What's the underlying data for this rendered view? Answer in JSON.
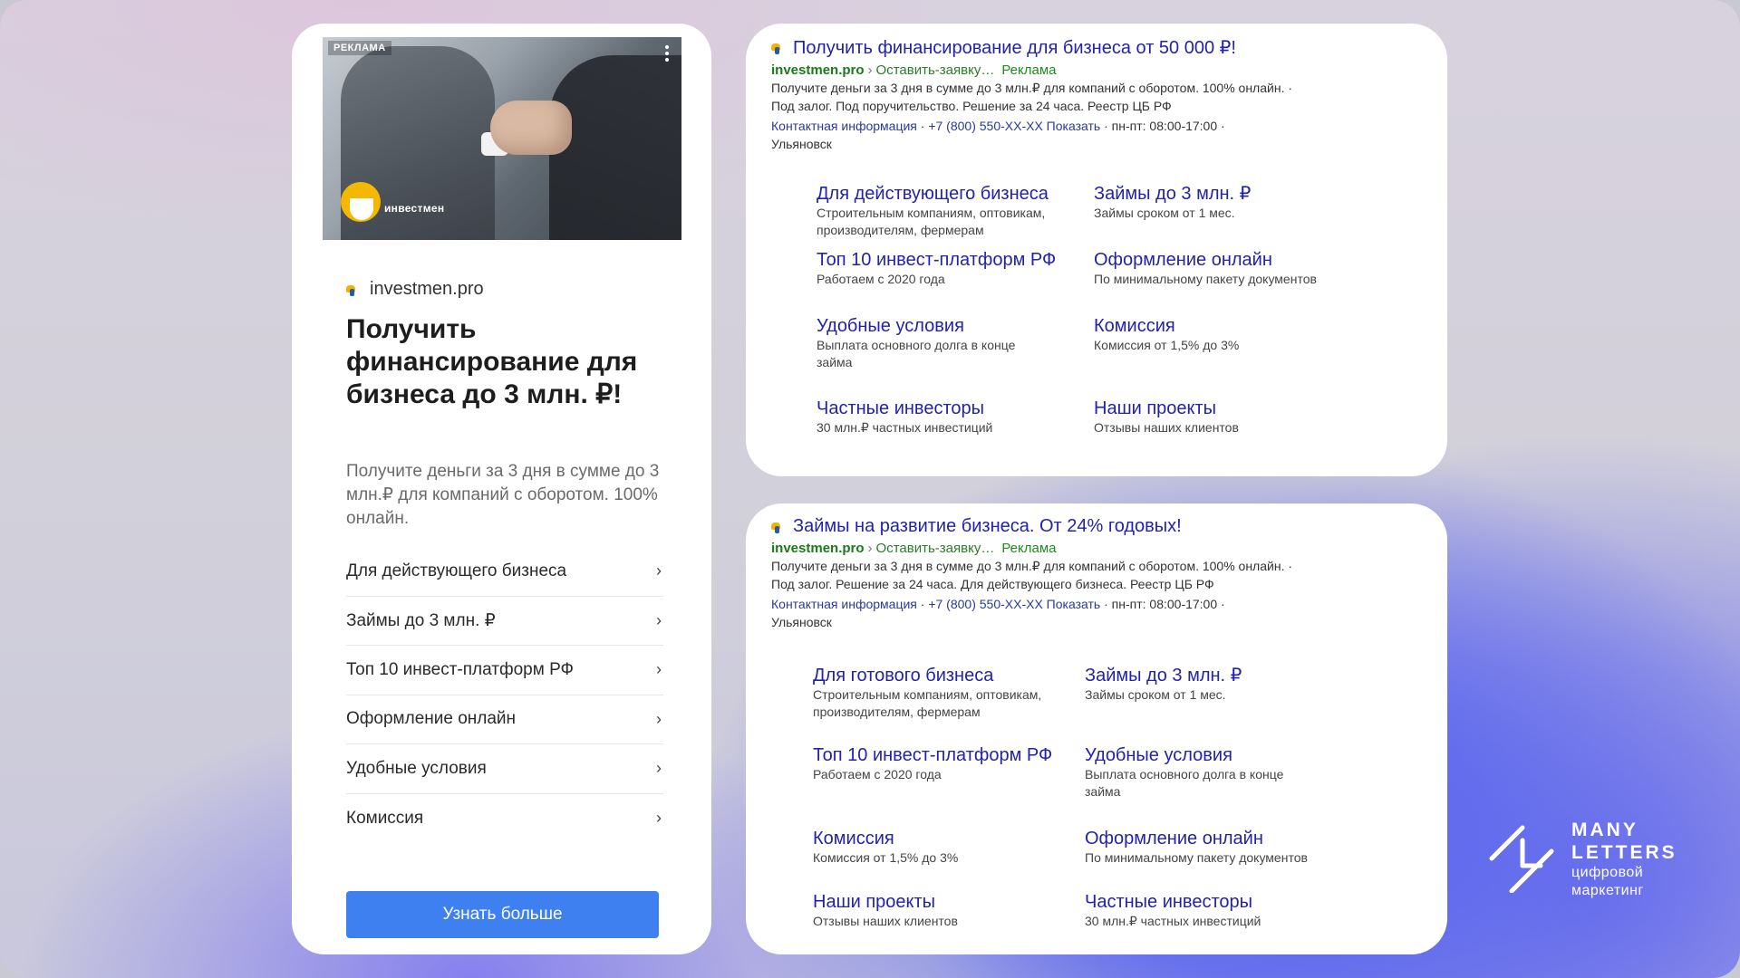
{
  "mobile_ad": {
    "ad_label": "РЕКЛАМА",
    "brand_name": "инвестмен",
    "site": "investmen.pro",
    "title": "Получить финансирование для бизнеса до 3 млн. ₽!",
    "description": "Получите деньги за 3 дня в сумме до 3 млн.₽ для компаний с оборотом. 100% онлайн.",
    "links": [
      "Для действующего бизнеса",
      "Займы до 3 млн. ₽",
      "Топ 10 инвест-платформ РФ",
      "Оформление онлайн",
      "Удобные условия",
      "Комиссия"
    ],
    "cta": "Узнать больше"
  },
  "search_ad_1": {
    "title": "Получить финансирование для бизнеса от 50 000 ₽!",
    "domain": "investmen.pro",
    "path": "Оставить-заявку…",
    "ad_tag": "Реклама",
    "text_line1": "Получите деньги за 3 дня в сумме до 3 млн.₽ для компаний с оборотом. 100% онлайн. ·",
    "text_line2": "Под залог. Под поручительство. Решение за 24 часа. Реестр ЦБ РФ",
    "contacts_link": "Контактная информация",
    "phone": "+7 (800) 550-ХХ-ХХ Показать",
    "hours": "пн-пт: 08:00-17:00",
    "city": "Ульяновск",
    "sitelinks": [
      {
        "title": "Для действующего бизнеса",
        "desc": "Строительным компаниям, оптовикам, производителям, фермерам"
      },
      {
        "title": "Займы до 3 млн. ₽",
        "desc": "Займы сроком от 1 мес."
      },
      {
        "title": "Топ 10 инвест-платформ РФ",
        "desc": "Работаем с 2020 года"
      },
      {
        "title": "Оформление онлайн",
        "desc": "По минимальному пакету документов"
      },
      {
        "title": "Удобные условия",
        "desc": "Выплата основного долга в конце займа"
      },
      {
        "title": "Комиссия",
        "desc": "Комиссия от 1,5% до 3%"
      },
      {
        "title": "Частные инвесторы",
        "desc": "30 млн.₽ частных инвестиций"
      },
      {
        "title": "Наши проекты",
        "desc": "Отзывы наших клиентов"
      }
    ]
  },
  "search_ad_2": {
    "title": "Займы на развитие бизнеса. От 24% годовых!",
    "domain": "investmen.pro",
    "path": "Оставить-заявку…",
    "ad_tag": "Реклама",
    "text_line1": "Получите деньги за 3 дня в сумме до 3 млн.₽ для компаний с оборотом. 100% онлайн. ·",
    "text_line2": "Под залог. Решение за 24 часа. Для действующего бизнеса. Реестр ЦБ РФ",
    "contacts_link": "Контактная информация",
    "phone": "+7 (800) 550-ХХ-ХХ Показать",
    "hours": "пн-пт: 08:00-17:00",
    "city": "Ульяновск",
    "sitelinks": [
      {
        "title": "Для готового бизнеса",
        "desc": "Строительным компаниям, оптовикам, производителям, фермерам"
      },
      {
        "title": "Займы до 3 млн. ₽",
        "desc": "Займы сроком от 1 мес."
      },
      {
        "title": "Топ 10 инвест-платформ РФ",
        "desc": "Работаем с 2020 года"
      },
      {
        "title": "Удобные условия",
        "desc": "Выплата основного долга в конце займа"
      },
      {
        "title": "Комиссия",
        "desc": "Комиссия от 1,5% до 3%"
      },
      {
        "title": "Оформление онлайн",
        "desc": "По минимальному пакету документов"
      },
      {
        "title": "Наши проекты",
        "desc": "Отзывы наших клиентов"
      },
      {
        "title": "Частные инвесторы",
        "desc": "30 млн.₽ частных инвестиций"
      }
    ]
  },
  "logo": {
    "line1": "MANY",
    "line2": "LETTERS",
    "sub1": "цифровой",
    "sub2": "маркетинг"
  }
}
